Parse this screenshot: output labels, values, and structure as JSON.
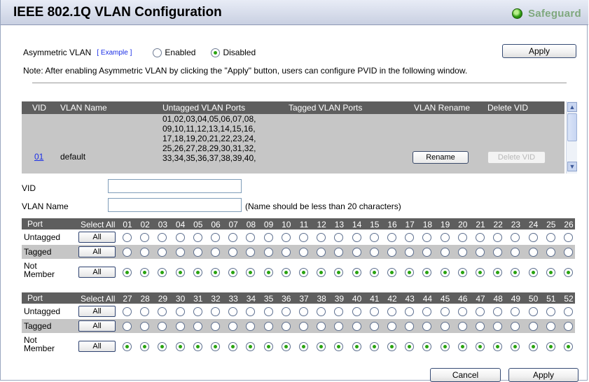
{
  "header": {
    "title": "IEEE 802.1Q VLAN Configuration",
    "brand": "Safeguard",
    "brand_color": "#7fa87e",
    "status_color": "#2f9b12"
  },
  "asym": {
    "label": "Asymmetric VLAN",
    "example_link": "[ Example ]",
    "enabled_label": "Enabled",
    "disabled_label": "Disabled",
    "selected": "Disabled",
    "apply_label": "Apply",
    "note": "Note: After enabling Asymmetric VLAN by clicking the \"Apply\" button, users can configure PVID in the following window."
  },
  "vlan_table": {
    "headers": {
      "vid": "VID",
      "name": "VLAN Name",
      "untagged": "Untagged VLAN Ports",
      "tagged": "Tagged VLAN Ports",
      "rename": "VLAN Rename",
      "delete": "Delete VID"
    },
    "rows": [
      {
        "vid": "01",
        "name": "default",
        "untagged_lines": [
          "01,02,03,04,05,06,07,08,",
          "09,10,11,12,13,14,15,16,",
          "17,18,19,20,21,22,23,24,",
          "25,26,27,28,29,30,31,32,",
          "33,34,35,36,37,38,39,40,"
        ],
        "tagged": "",
        "rename_label": "Rename",
        "delete_label": "Delete VID"
      }
    ]
  },
  "form": {
    "vid_label": "VID",
    "vid_value": "",
    "name_label": "VLAN Name",
    "name_value": "",
    "name_hint": "(Name should be less than 20 characters)"
  },
  "port_grid": {
    "port_label": "Port",
    "select_all_label": "Select All",
    "all_button_label": "All",
    "row_labels": {
      "untagged": "Untagged",
      "tagged": "Tagged",
      "not_member": "Not Member"
    },
    "groups": [
      {
        "ports": [
          "01",
          "02",
          "03",
          "04",
          "05",
          "06",
          "07",
          "08",
          "09",
          "10",
          "11",
          "12",
          "13",
          "14",
          "15",
          "16",
          "17",
          "18",
          "19",
          "20",
          "21",
          "22",
          "23",
          "24",
          "25",
          "26"
        ],
        "selected": "not_member"
      },
      {
        "ports": [
          "27",
          "28",
          "29",
          "30",
          "31",
          "32",
          "33",
          "34",
          "35",
          "36",
          "37",
          "38",
          "39",
          "40",
          "41",
          "42",
          "43",
          "44",
          "45",
          "46",
          "47",
          "48",
          "49",
          "50",
          "51",
          "52"
        ],
        "selected": "not_member"
      }
    ]
  },
  "footer": {
    "cancel_label": "Cancel",
    "apply_label": "Apply"
  }
}
